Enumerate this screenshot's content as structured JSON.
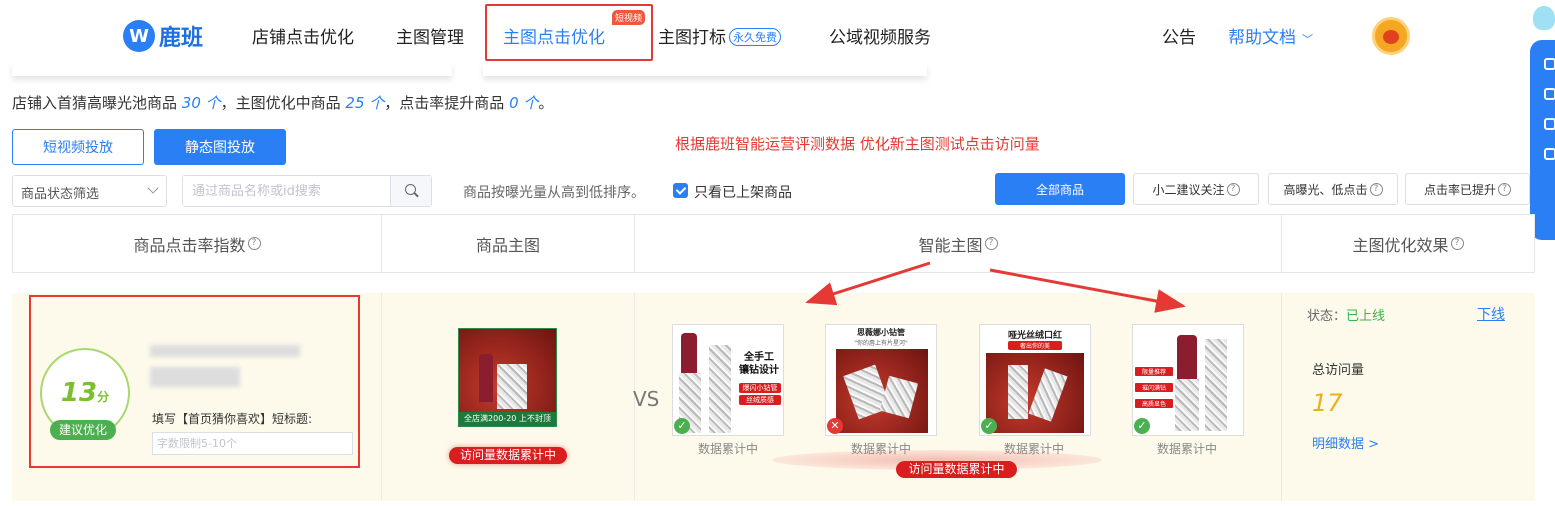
{
  "nav": {
    "logo_mark": "W",
    "logo_text": "鹿班",
    "items": [
      "店铺点击优化",
      "主图管理",
      "主图点击优化",
      "主图打标",
      "公域视频服务"
    ],
    "hot_badge": "短视频",
    "free_tag": "永久免费",
    "announcement": "公告",
    "help_docs": "帮助文档"
  },
  "summary": {
    "p1": "店铺入首猜高曝光池商品 ",
    "n1": "30 个",
    "p2": "，主图优化中商品 ",
    "n2": "25 个",
    "p3": "，点击率提升商品 ",
    "n3": "0 个",
    "p4": "。"
  },
  "actions": {
    "short_video": "短视频投放",
    "static_image": "静态图投放",
    "red_note": "根据鹿班智能运营评测数据  优化新主图测试点击访问量"
  },
  "filters": {
    "status_select": "商品状态筛选",
    "search_placeholder": "通过商品名称或id搜索",
    "sort_text": "商品按曝光量从高到低排序。",
    "only_listed": "只看已上架商品",
    "tabs": [
      "全部商品",
      "小二建议关注",
      "高曝光、低点击",
      "点击率已提升"
    ]
  },
  "table": {
    "headers": [
      "商品点击率指数",
      "商品主图",
      "智能主图",
      "主图优化效果"
    ]
  },
  "row": {
    "score": "13",
    "score_unit": "分",
    "score_tag": "建议优化",
    "fill_label": "填写【首页猜你喜欢】短标题:",
    "title_placeholder": "字数限制5-10个",
    "main_banner": "全店满200-20 上不封顶",
    "main_pill": "访问量数据累计中",
    "vs": "VS",
    "smart_images": [
      {
        "texts": [
          "全手工",
          "镶钻设计",
          "爆闪小钻管",
          "丝绒质感"
        ],
        "accum": "数据累计中",
        "status": "ok"
      },
      {
        "texts": [
          "思薇娜小钻管",
          "\"你的唇上有片星河\""
        ],
        "accum": "数据累计中",
        "status": "bad"
      },
      {
        "texts": [
          "哑光丝绒口红",
          "奢出你的美"
        ],
        "accum": "数据累计中",
        "status": "ok"
      },
      {
        "texts": [
          "限量推荐",
          "璀闪满钻",
          "高质显色"
        ],
        "accum": "数据累计中",
        "status": "ok"
      }
    ],
    "smart_pill": "访问量数据累计中",
    "status_label": "状态：",
    "status_value": "已上线",
    "offline_link": "下线",
    "visits_label": "总访问量",
    "visits_value": "17",
    "detail_link": "明细数据 >"
  },
  "colors": {
    "accent": "#2b7ff5",
    "alert": "#e53935",
    "success": "#4caf50"
  }
}
